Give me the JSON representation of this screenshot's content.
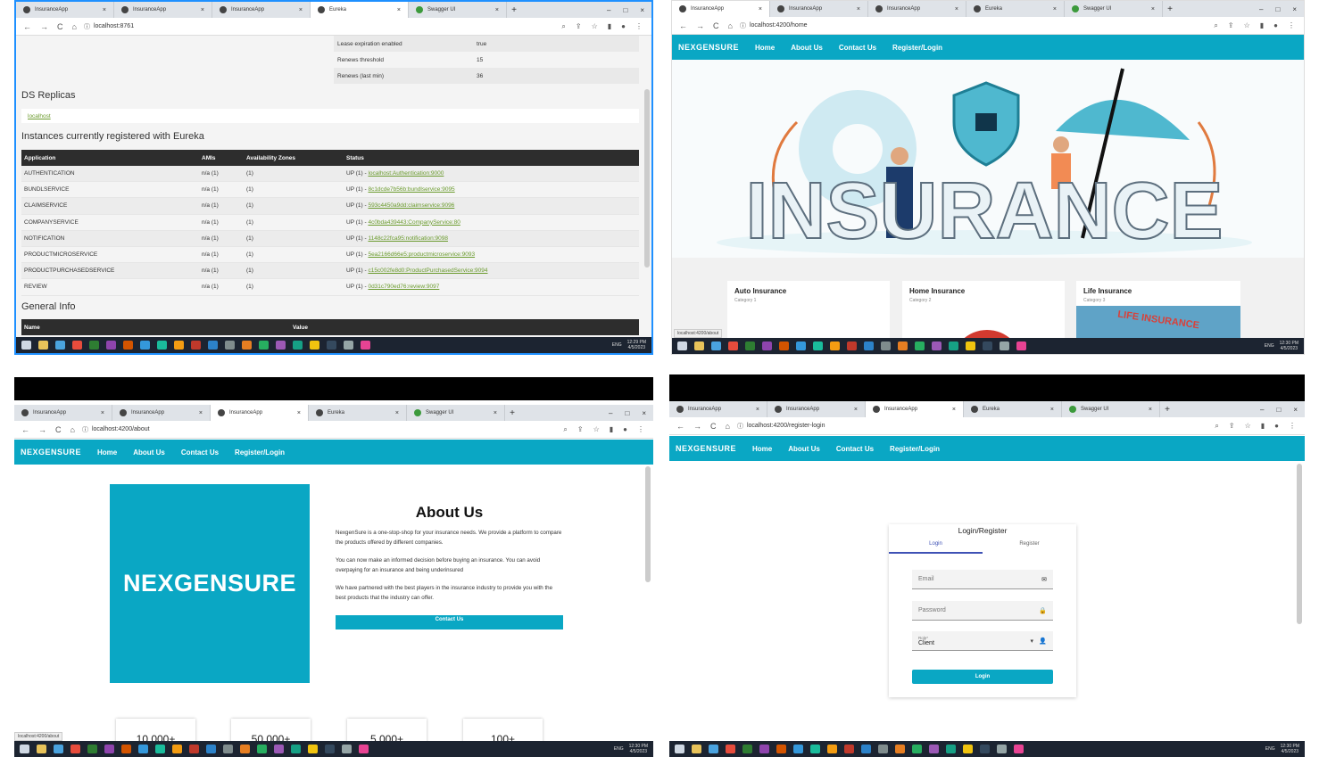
{
  "colors": {
    "accent": "#0aa7c4",
    "highlight_border": "#1e90ff",
    "taskbar": "#1c2431"
  },
  "browser": {
    "tabs": [
      "InsuranceApp",
      "InsuranceApp",
      "InsuranceApp",
      "Eureka",
      "Swagger UI"
    ],
    "tab_close": "×",
    "new_tab": "+",
    "win_min": "–",
    "win_max": "□",
    "win_close": "×",
    "nav": {
      "back": "←",
      "forward": "→",
      "reload": "C",
      "home": "⌂"
    },
    "tools": {
      "zoom": "⌕",
      "share": "⇪",
      "star": "☆",
      "sidebar": "▮",
      "profile": "●",
      "menu": "⋮"
    },
    "site_icon": "ⓘ"
  },
  "taskbar": {
    "clock_p1": "12:29 PM",
    "clock_p2": "12:30 PM",
    "clock_p3": "12:30 PM",
    "clock_p4": "12:30 PM",
    "date": "4/5/2023",
    "lang": "ENG"
  },
  "app": {
    "brand": "NEXGENSURE",
    "nav": [
      "Home",
      "About Us",
      "Contact Us",
      "Register/Login"
    ]
  },
  "eureka": {
    "url": "localhost:8761",
    "lease": [
      {
        "k": "Lease expiration enabled",
        "v": "true"
      },
      {
        "k": "Renews threshold",
        "v": "15"
      },
      {
        "k": "Renews (last min)",
        "v": "36"
      }
    ],
    "ds_title": "DS Replicas",
    "ds_link": "localhost",
    "instances_title": "Instances currently registered with Eureka",
    "headers": [
      "Application",
      "AMIs",
      "Availability Zones",
      "Status"
    ],
    "rows": [
      {
        "app": "AUTHENTICATION",
        "ami": "n/a (1)",
        "az": "(1)",
        "st": "UP (1) - ",
        "link": "localhost:Authentication:9000"
      },
      {
        "app": "BUNDLSERVICE",
        "ami": "n/a (1)",
        "az": "(1)",
        "st": "UP (1) - ",
        "link": "8c1dcde7b56b:bundlservice:9095"
      },
      {
        "app": "CLAIMSERVICE",
        "ami": "n/a (1)",
        "az": "(1)",
        "st": "UP (1) - ",
        "link": "593c4450a9dd:claimservice:9096"
      },
      {
        "app": "COMPANYSERVICE",
        "ami": "n/a (1)",
        "az": "(1)",
        "st": "UP (1) - ",
        "link": "4c0bda439443:CompanyService:80"
      },
      {
        "app": "NOTIFICATION",
        "ami": "n/a (1)",
        "az": "(1)",
        "st": "UP (1) - ",
        "link": "1148c22fca95:notification:9098"
      },
      {
        "app": "PRODUCTMICROSERVICE",
        "ami": "n/a (1)",
        "az": "(1)",
        "st": "UP (1) - ",
        "link": "5ea2166d66e5:productmicroservice:9093"
      },
      {
        "app": "PRODUCTPURCHASEDSERVICE",
        "ami": "n/a (1)",
        "az": "(1)",
        "st": "UP (1) - ",
        "link": "c15c002fe8d0:ProductPurchasedService:9094"
      },
      {
        "app": "REVIEW",
        "ami": "n/a (1)",
        "az": "(1)",
        "st": "UP (1) - ",
        "link": "0d31c790ed76:review:9097"
      }
    ],
    "general_title": "General Info",
    "gen_headers": [
      "Name",
      "Value"
    ]
  },
  "home": {
    "url": "localhost:4200/home",
    "hero": "INSURANCE",
    "cards": [
      {
        "t": "Auto Insurance",
        "s": "Category 1"
      },
      {
        "t": "Home Insurance",
        "s": "Category 2"
      },
      {
        "t": "Life Insurance",
        "s": "Category 3"
      }
    ],
    "life_img_text": "LIFE INSURANCE",
    "status_url": "localhost:4200/about"
  },
  "about": {
    "url": "localhost:4200/about",
    "logo": "NEXGENSURE",
    "title": "About Us",
    "p1": "NexgenSure is a one-stop-shop for your insurance needs. We provide a platform to compare the products offered by different companies.",
    "p2": "You can now make an informed decision before buying an insurance. You can avoid overpaying for an insurance and being underinsured",
    "p3": "We have partnered with the best players in the insurance industry to provide you with the best products that the industry can offer.",
    "contact_btn": "Contact Us",
    "stats": [
      "10,000+",
      "50,000+",
      "5,000+",
      "100+"
    ],
    "status_url": "localhost:4200/about"
  },
  "login": {
    "url": "localhost:4200/register-login",
    "title": "Login/Register",
    "tabs": [
      "Login",
      "Register"
    ],
    "email": "Email",
    "password": "Password",
    "role_label": "Role*",
    "role_value": "Client",
    "button": "Login",
    "email_icon": "✉",
    "lock_icon": "🔒",
    "user_icon": "👤",
    "caret": "▾"
  }
}
